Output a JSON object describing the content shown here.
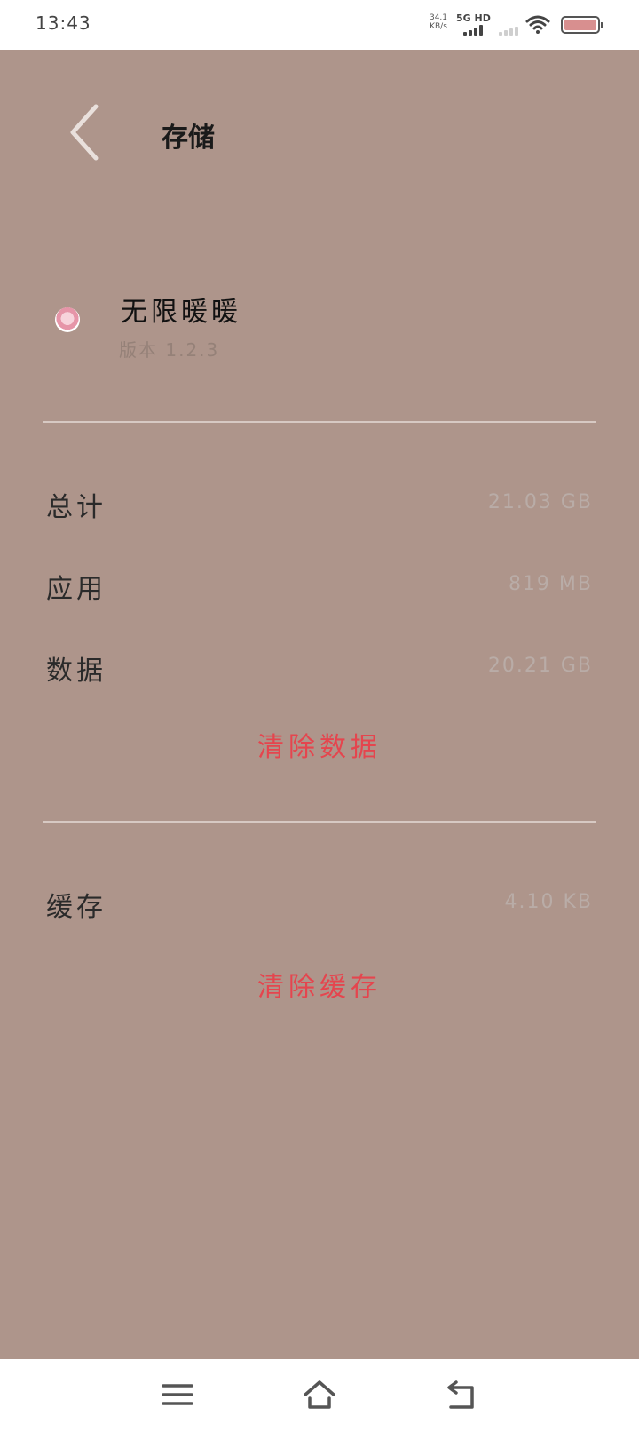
{
  "status_bar": {
    "time": "13:43",
    "net_speed_value": "34.1",
    "net_speed_unit": "KB/s",
    "network_type": "5G HD",
    "battery_color": "#d88f8f"
  },
  "header": {
    "title": "存储",
    "back_icon": "chevron-left-icon"
  },
  "app": {
    "name": "无限暖暖",
    "version": "版本 1.2.3"
  },
  "storage": {
    "rows": [
      {
        "label": "总计",
        "value": "21.03 GB"
      },
      {
        "label": "应用",
        "value": "819 MB"
      },
      {
        "label": "数据",
        "value": "20.21 GB"
      }
    ],
    "clear_data_label": "清除数据",
    "cache": {
      "label": "缓存",
      "value": "4.10 KB"
    },
    "clear_cache_label": "清除缓存"
  },
  "colors": {
    "background": "#ae958b",
    "accent_red": "#e5454e",
    "value_gray": "#b9aca7"
  },
  "nav_bar": {
    "menu_icon": "menu-icon",
    "home_icon": "home-icon",
    "back_icon": "return-icon"
  }
}
